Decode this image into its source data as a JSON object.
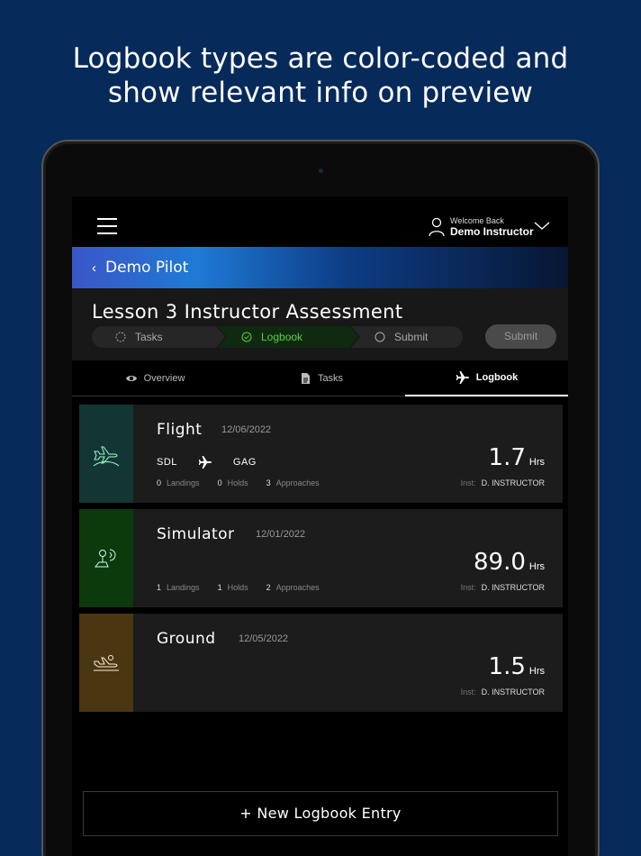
{
  "headline": {
    "line1": "Logbook types are color-coded and",
    "line2": "show relevant info on preview"
  },
  "header": {
    "welcome": "Welcome Back",
    "user_name": "Demo Instructor"
  },
  "pilot": {
    "back_glyph": "‹",
    "name": "Demo Pilot"
  },
  "lesson": {
    "title": "Lesson 3 Instructor Assessment",
    "steps": [
      {
        "label": "Tasks",
        "state": "in-progress"
      },
      {
        "label": "Logbook",
        "state": "complete"
      },
      {
        "label": "Submit",
        "state": "pending"
      }
    ],
    "submit_label": "Submit"
  },
  "tabs": [
    {
      "label": "Overview",
      "icon": "eye-icon"
    },
    {
      "label": "Tasks",
      "icon": "document-icon"
    },
    {
      "label": "Logbook",
      "icon": "airplane-icon",
      "active": true
    }
  ],
  "entries": [
    {
      "type": "Flight",
      "date": "12/06/2022",
      "color": "#133634",
      "icon": "airplane-takeoff-icon",
      "from": "SDL",
      "to": "GAG",
      "landings": "0",
      "holds": "0",
      "approaches": "3",
      "hours": "1.7",
      "instructor": "D. INSTRUCTOR"
    },
    {
      "type": "Simulator",
      "date": "12/01/2022",
      "color": "#0c3a0c",
      "icon": "simulator-icon",
      "landings": "1",
      "holds": "1",
      "approaches": "2",
      "hours": "89.0",
      "instructor": "D. INSTRUCTOR"
    },
    {
      "type": "Ground",
      "date": "12/05/2022",
      "color": "#4a3610",
      "icon": "ground-school-icon",
      "hours": "1.5",
      "instructor": "D. INSTRUCTOR"
    }
  ],
  "labels": {
    "landings": "Landings",
    "holds": "Holds",
    "approaches": "Approaches",
    "hrs": "Hrs",
    "inst": "Inst:"
  },
  "new_entry_label": "+ New Logbook Entry"
}
